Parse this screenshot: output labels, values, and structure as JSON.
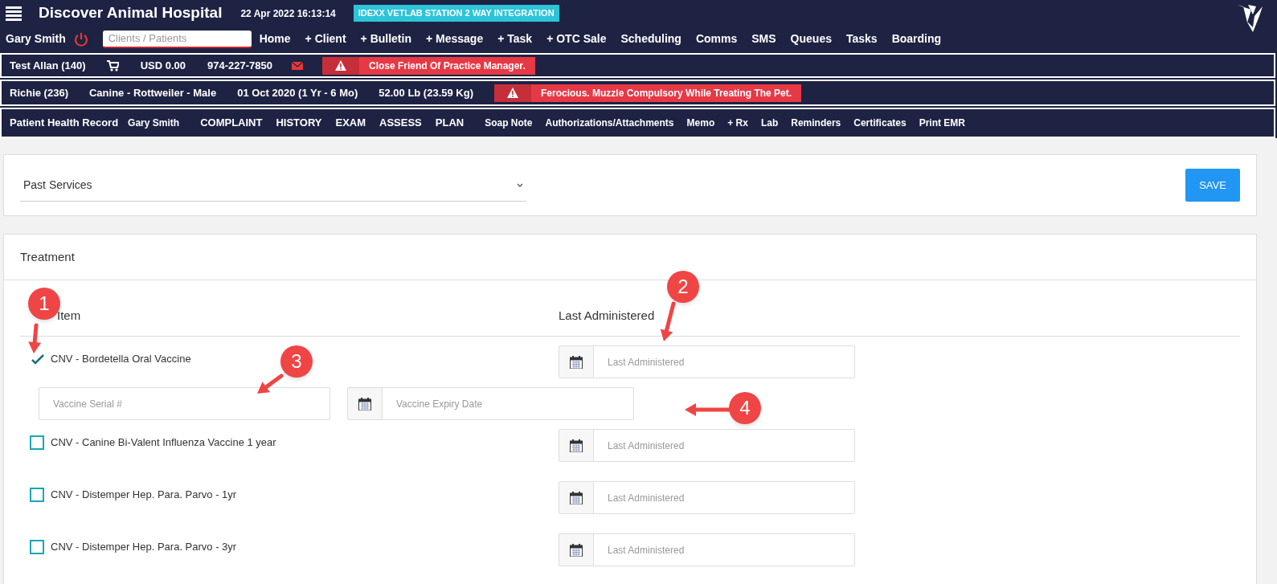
{
  "header": {
    "title": "Discover Animal Hospital",
    "datetime": "22 Apr 2022 16:13:14",
    "integration_badge": "IDEXX VETLAB STATION 2 WAY INTEGRATION",
    "user": "Gary Smith",
    "search": {
      "placeholder": "Clients / Patients"
    },
    "nav": [
      "Home",
      "+ Client",
      "+ Bulletin",
      "+ Message",
      "+ Task",
      "+ OTC Sale",
      "Scheduling",
      "Comms",
      "SMS",
      "Queues",
      "Tasks",
      "Boarding"
    ]
  },
  "client_bar": {
    "name": "Test Allan (140)",
    "balance": "USD 0.00",
    "phone": "974-227-7850",
    "alert": "Close Friend Of Practice Manager."
  },
  "patient_bar": {
    "items": [
      "Richie (236)",
      "Canine - Rottweiler - Male",
      "01 Oct 2020 (1 Yr - 6 Mo)",
      "52.00 Lb (23.59 Kg)"
    ],
    "alert": "Ferocious. Muzzle Compulsory While Treating The Pet."
  },
  "record_bar": {
    "title": "Patient Health Record",
    "user": "Gary Smith",
    "sections": [
      "COMPLAINT",
      "HISTORY",
      "EXAM",
      "ASSESS",
      "PLAN"
    ],
    "links": [
      "Soap Note",
      "Authorizations/Attachments",
      "Memo",
      "+ Rx",
      "Lab",
      "Reminders",
      "Certificates",
      "Print EMR"
    ]
  },
  "services": {
    "select": "Past Services",
    "save": "SAVE"
  },
  "treatment": {
    "title": "Treatment",
    "columns": [
      "Item",
      "Last Administered"
    ],
    "rows": [
      {
        "label": "CNV - Bordetella Oral Vaccine",
        "checked": true,
        "date_placeholder": "Last Administered",
        "details": {
          "serial_placeholder": "Vaccine Serial #",
          "expiry_placeholder": "Vaccine Expiry Date"
        }
      },
      {
        "label": "CNV - Canine Bi-Valent Influenza Vaccine 1 year",
        "checked": false,
        "date_placeholder": "Last Administered"
      },
      {
        "label": "CNV - Distemper Hep. Para. Parvo - 1yr",
        "checked": false,
        "date_placeholder": "Last Administered"
      },
      {
        "label": "CNV - Distemper Hep. Para. Parvo - 3yr",
        "checked": false,
        "date_placeholder": "Last Administered"
      }
    ]
  },
  "callouts": [
    "1",
    "2",
    "3",
    "4"
  ]
}
